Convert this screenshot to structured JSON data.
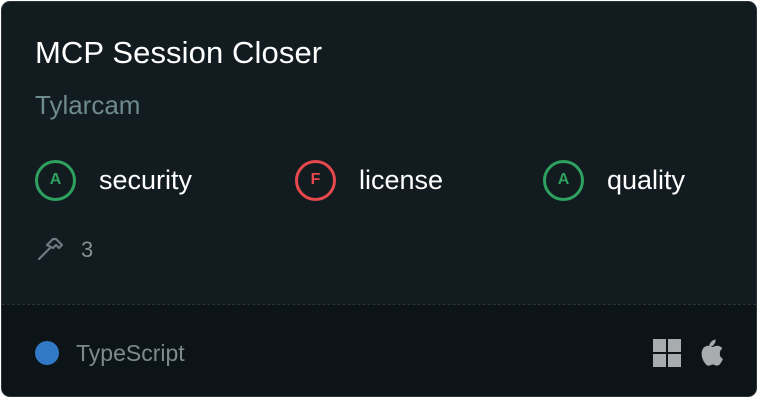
{
  "server": {
    "title": "MCP Session Closer",
    "author": "Tylarcam"
  },
  "grades": [
    {
      "letter": "A",
      "label": "security",
      "color": "#2ea05f",
      "text_color": "#2ea05f"
    },
    {
      "letter": "F",
      "label": "license",
      "color": "#e5484d",
      "text_color": "#e5484d"
    },
    {
      "letter": "A",
      "label": "quality",
      "color": "#2ea05f",
      "text_color": "#2ea05f"
    }
  ],
  "tools": {
    "icon": "hammer-icon",
    "count": "3"
  },
  "footer": {
    "language": "TypeScript",
    "language_color": "#3178c6",
    "platforms": [
      "windows-icon",
      "apple-icon"
    ]
  },
  "colors": {
    "card_background": "#121b1f",
    "footer_background": "#0d1417",
    "pass": "#2ea05f",
    "fail": "#e5484d"
  }
}
